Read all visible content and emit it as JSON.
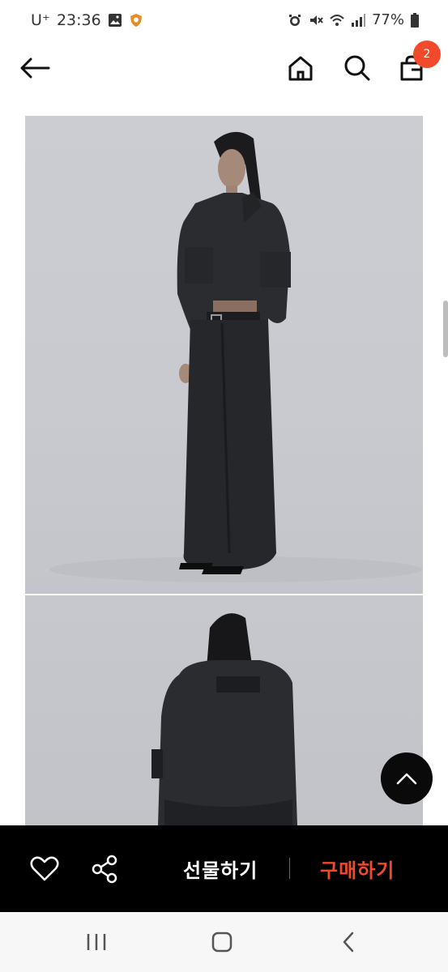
{
  "status_bar": {
    "carrier": "U⁺",
    "time": "23:36",
    "battery": "77%"
  },
  "nav": {
    "cart_badge": "2"
  },
  "bottom_bar": {
    "gift_label": "선물하기",
    "buy_label": "구매하기"
  },
  "colors": {
    "accent": "#f24a2b",
    "bar_bg": "#000000"
  }
}
